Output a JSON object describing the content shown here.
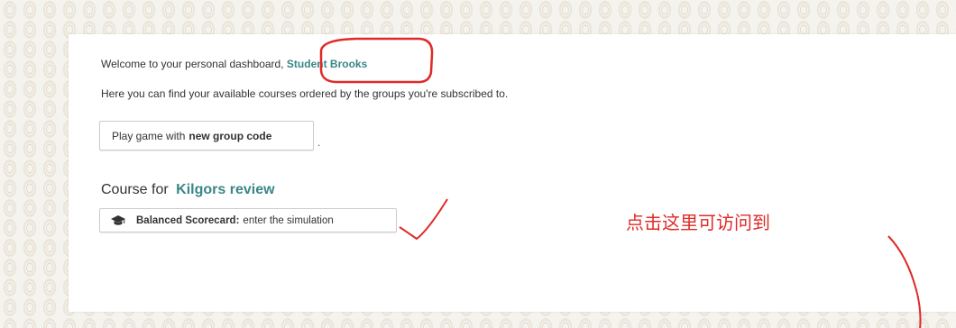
{
  "dashboard": {
    "welcome_prefix": "Welcome to your personal dashboard, ",
    "student_name": "Student Brooks",
    "intro_text": "Here you can find your available courses ordered by the groups you're subscribed to.",
    "play_button": {
      "label": "Play game with",
      "label_strong": "new group code"
    },
    "trailing_punct": ".",
    "course_heading_prefix": "Course for",
    "course_name": "Kilgors review",
    "course_button": {
      "label_strong": "Balanced Scorecard:",
      "label": "enter the simulation",
      "icon": "graduation-cap-icon"
    }
  },
  "annotation": {
    "text": "点击这里可访问到",
    "color": "#e02a28"
  },
  "colors": {
    "accent_teal": "#3b8686",
    "annotation_red": "#e02a28"
  }
}
